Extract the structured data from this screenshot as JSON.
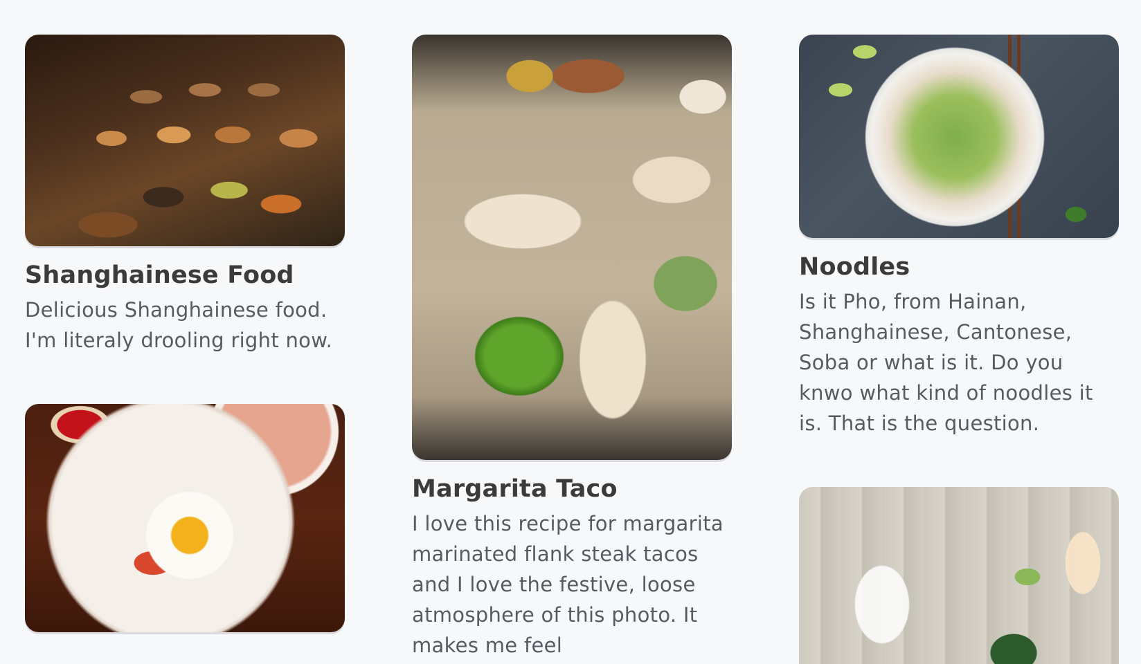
{
  "cards": [
    {
      "title": "Shanghainese Food",
      "description": "Delicious Shanghainese food. I'm literaly drooling right now.",
      "image": "dim-sum-steamer-baskets-photo"
    },
    {
      "title": "Margarita Taco",
      "description": "I love this recipe for margarita marinated flank steak tacos and I love the festive, loose atmosphere of this photo. It makes me feel",
      "image": "steak-tacos-with-lime-photo"
    },
    {
      "title": "Noodles",
      "description": "Is it Pho, from Hainan, Shanghainese, Cantonese, Soba or what is it. Do you knwo what kind of noodles it is. That is the question.",
      "image": "noodle-soup-bowl-with-chopsticks-photo"
    },
    {
      "title": "",
      "description": "",
      "image": "breakfast-egg-toast-tea-photo"
    },
    {
      "title": "",
      "description": "",
      "image": "cranberry-drinks-pitcher-photo"
    }
  ],
  "colors": {
    "background": "#f7f8fa",
    "title": "#3b3b3b",
    "body_text": "#555b62"
  }
}
